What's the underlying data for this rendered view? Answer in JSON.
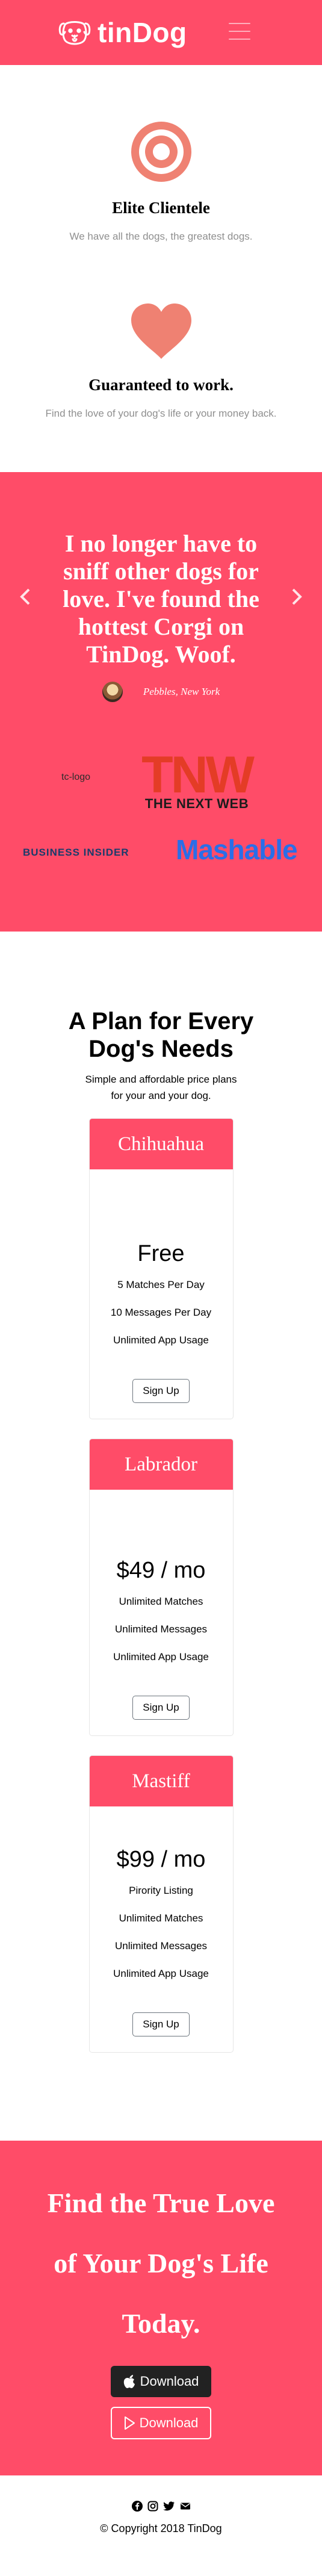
{
  "nav": {
    "brand": "tinDog",
    "logo_icon": "dog-face-icon",
    "menu_icon": "hamburger-icon"
  },
  "features": [
    {
      "icon": "target-icon",
      "title": "Elite Clientele",
      "text": "We have all the dogs, the greatest dogs."
    },
    {
      "icon": "heart-icon",
      "title": "Guaranteed to work.",
      "text": "Find the love of your dog's life or your money back."
    }
  ],
  "testimonial": {
    "quote": "I no longer have to sniff other dogs for love. I've found the hottest Corgi on TinDog. Woof.",
    "author": "Pebbles, New York",
    "prev_icon": "chevron-left-icon",
    "next_icon": "chevron-right-icon"
  },
  "press": {
    "tc_alt": "tc-logo",
    "tnw_mark": "TNW",
    "tnw_text": "THE NEXT WEB",
    "bi_text": "BUSINESS INSIDER",
    "mashable_text": "Mashable"
  },
  "pricing": {
    "title": "A Plan for Every Dog's Needs",
    "subtitle": "Simple and affordable price plans for your and your dog.",
    "plans": [
      {
        "name": "Chihuahua",
        "price": "Free",
        "features": [
          "5 Matches Per Day",
          "10 Messages Per Day",
          "Unlimited App Usage"
        ],
        "button": "Sign Up"
      },
      {
        "name": "Labrador",
        "price": "$49 / mo",
        "features": [
          "Unlimited Matches",
          "Unlimited Messages",
          "Unlimited App Usage"
        ],
        "button": "Sign Up"
      },
      {
        "name": "Mastiff",
        "price": "$99 / mo",
        "features": [
          "Pirority Listing",
          "Unlimited Matches",
          "Unlimited Messages",
          "Unlimited App Usage"
        ],
        "button": "Sign Up"
      }
    ]
  },
  "cta": {
    "title": "Find the True Love of Your Dog's Life Today.",
    "download_apple": "Download",
    "download_play": "Download"
  },
  "footer": {
    "social_icons": [
      "facebook-icon",
      "instagram-icon",
      "twitter-icon",
      "envelope-icon"
    ],
    "copyright": "© Copyright 2018 TinDog"
  },
  "colors": {
    "brand": "#ff4c68",
    "accent": "#ef8172",
    "dark_button": "#222222"
  }
}
